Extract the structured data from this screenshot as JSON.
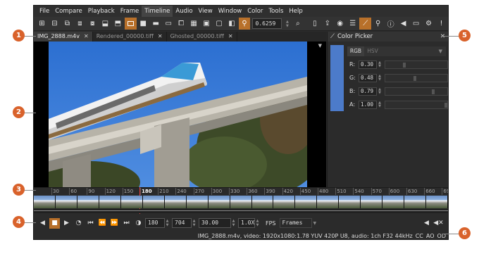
{
  "menu": [
    "File",
    "Compare",
    "Playback",
    "Frame",
    "Timeline",
    "Audio",
    "View",
    "Window",
    "Color",
    "Tools",
    "Help"
  ],
  "menu_active_index": 4,
  "toolbar": {
    "zoom_value": "0.6259"
  },
  "tabs": [
    {
      "label": "IMG_2888.m4v",
      "active": true
    },
    {
      "label": "Rendered_00000.tiff",
      "active": false
    },
    {
      "label": "Ghosted_00000.tiff",
      "active": false
    }
  ],
  "color_picker": {
    "title": "Color Picker",
    "swatch_color": "#4c7bca",
    "modes": [
      "RGB",
      "HSV"
    ],
    "active_mode": "RGB",
    "channels": [
      {
        "label": "R:",
        "value": "0.30",
        "level": 0.3
      },
      {
        "label": "G:",
        "value": "0.48",
        "level": 0.48
      },
      {
        "label": "B:",
        "value": "0.79",
        "level": 0.79
      },
      {
        "label": "A:",
        "value": "1.00",
        "level": 1.0
      }
    ]
  },
  "timeline": {
    "ticks": [
      "30",
      "60",
      "90",
      "120",
      "150",
      "180",
      "210",
      "240",
      "270",
      "300",
      "330",
      "360",
      "390",
      "420",
      "450",
      "480",
      "510",
      "540",
      "570",
      "600",
      "630",
      "660",
      "690"
    ],
    "current_frame_label": "180",
    "thumbnail_count": 19
  },
  "playback": {
    "current_frame": "180",
    "end_frame": "704",
    "fps_value": "30.00",
    "speed": "1.0X",
    "fps_label": "FPS",
    "time_mode": "Frames"
  },
  "status": {
    "info": "IMG_2888.m4v, video: 1920x1080:1.78 YUV 420P U8, audio: 1ch F32 44kHz",
    "cc": "CC",
    "ao": "AO",
    "od": "OD"
  },
  "markers": [
    "1",
    "2",
    "3",
    "4",
    "5",
    "6"
  ],
  "accent_color": "#b8702a",
  "marker_color": "#d9622b"
}
